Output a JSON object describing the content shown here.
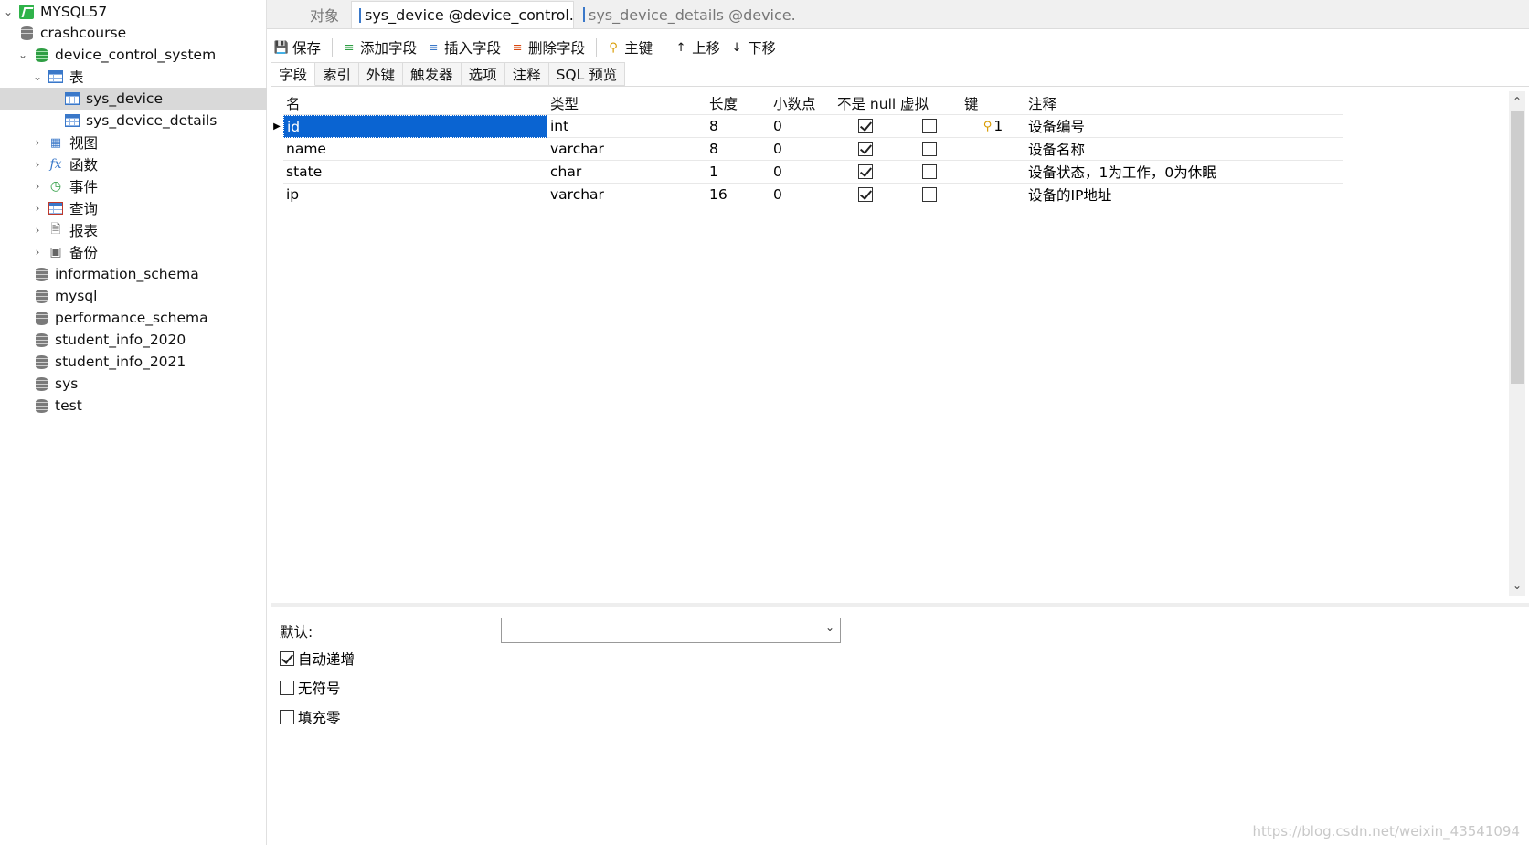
{
  "tree": {
    "connection": "MYSQL57",
    "items": [
      {
        "label": "crashcourse"
      },
      {
        "label": "device_control_system"
      },
      {
        "label": "表"
      },
      {
        "label": "sys_device"
      },
      {
        "label": "sys_device_details"
      },
      {
        "label": "视图"
      },
      {
        "label": "函数"
      },
      {
        "label": "事件"
      },
      {
        "label": "查询"
      },
      {
        "label": "报表"
      },
      {
        "label": "备份"
      },
      {
        "label": "information_schema"
      },
      {
        "label": "mysql"
      },
      {
        "label": "performance_schema"
      },
      {
        "label": "student_info_2020"
      },
      {
        "label": "student_info_2021"
      },
      {
        "label": "sys"
      },
      {
        "label": "test"
      }
    ]
  },
  "tabs": {
    "objects": "对象",
    "tab1": "sys_device @device_control...",
    "tab2": "sys_device_details @device..."
  },
  "toolbar": {
    "save": "保存",
    "add_field": "添加字段",
    "insert_field": "插入字段",
    "delete_field": "删除字段",
    "primary_key": "主键",
    "move_up": "上移",
    "move_down": "下移"
  },
  "subtabs": [
    "字段",
    "索引",
    "外键",
    "触发器",
    "选项",
    "注释",
    "SQL 预览"
  ],
  "grid": {
    "headers": [
      "名",
      "类型",
      "长度",
      "小数点",
      "不是 null",
      "虚拟",
      "键",
      "注释"
    ],
    "rows": [
      {
        "name": "id",
        "type": "int",
        "length": "8",
        "decimals": "0",
        "not_null": true,
        "virtual": false,
        "key": "1",
        "comment": "设备编号"
      },
      {
        "name": "name",
        "type": "varchar",
        "length": "8",
        "decimals": "0",
        "not_null": true,
        "virtual": false,
        "key": "",
        "comment": "设备名称"
      },
      {
        "name": "state",
        "type": "char",
        "length": "1",
        "decimals": "0",
        "not_null": true,
        "virtual": false,
        "key": "",
        "comment": "设备状态，1为工作，0为休眠"
      },
      {
        "name": "ip",
        "type": "varchar",
        "length": "16",
        "decimals": "0",
        "not_null": true,
        "virtual": false,
        "key": "",
        "comment": "设备的IP地址"
      }
    ]
  },
  "bottom": {
    "default_label": "默认:",
    "default_value": "",
    "auto_increment": "自动递增",
    "unsigned": "无符号",
    "zerofill": "填充零"
  },
  "watermark": "https://blog.csdn.net/weixin_43541094"
}
